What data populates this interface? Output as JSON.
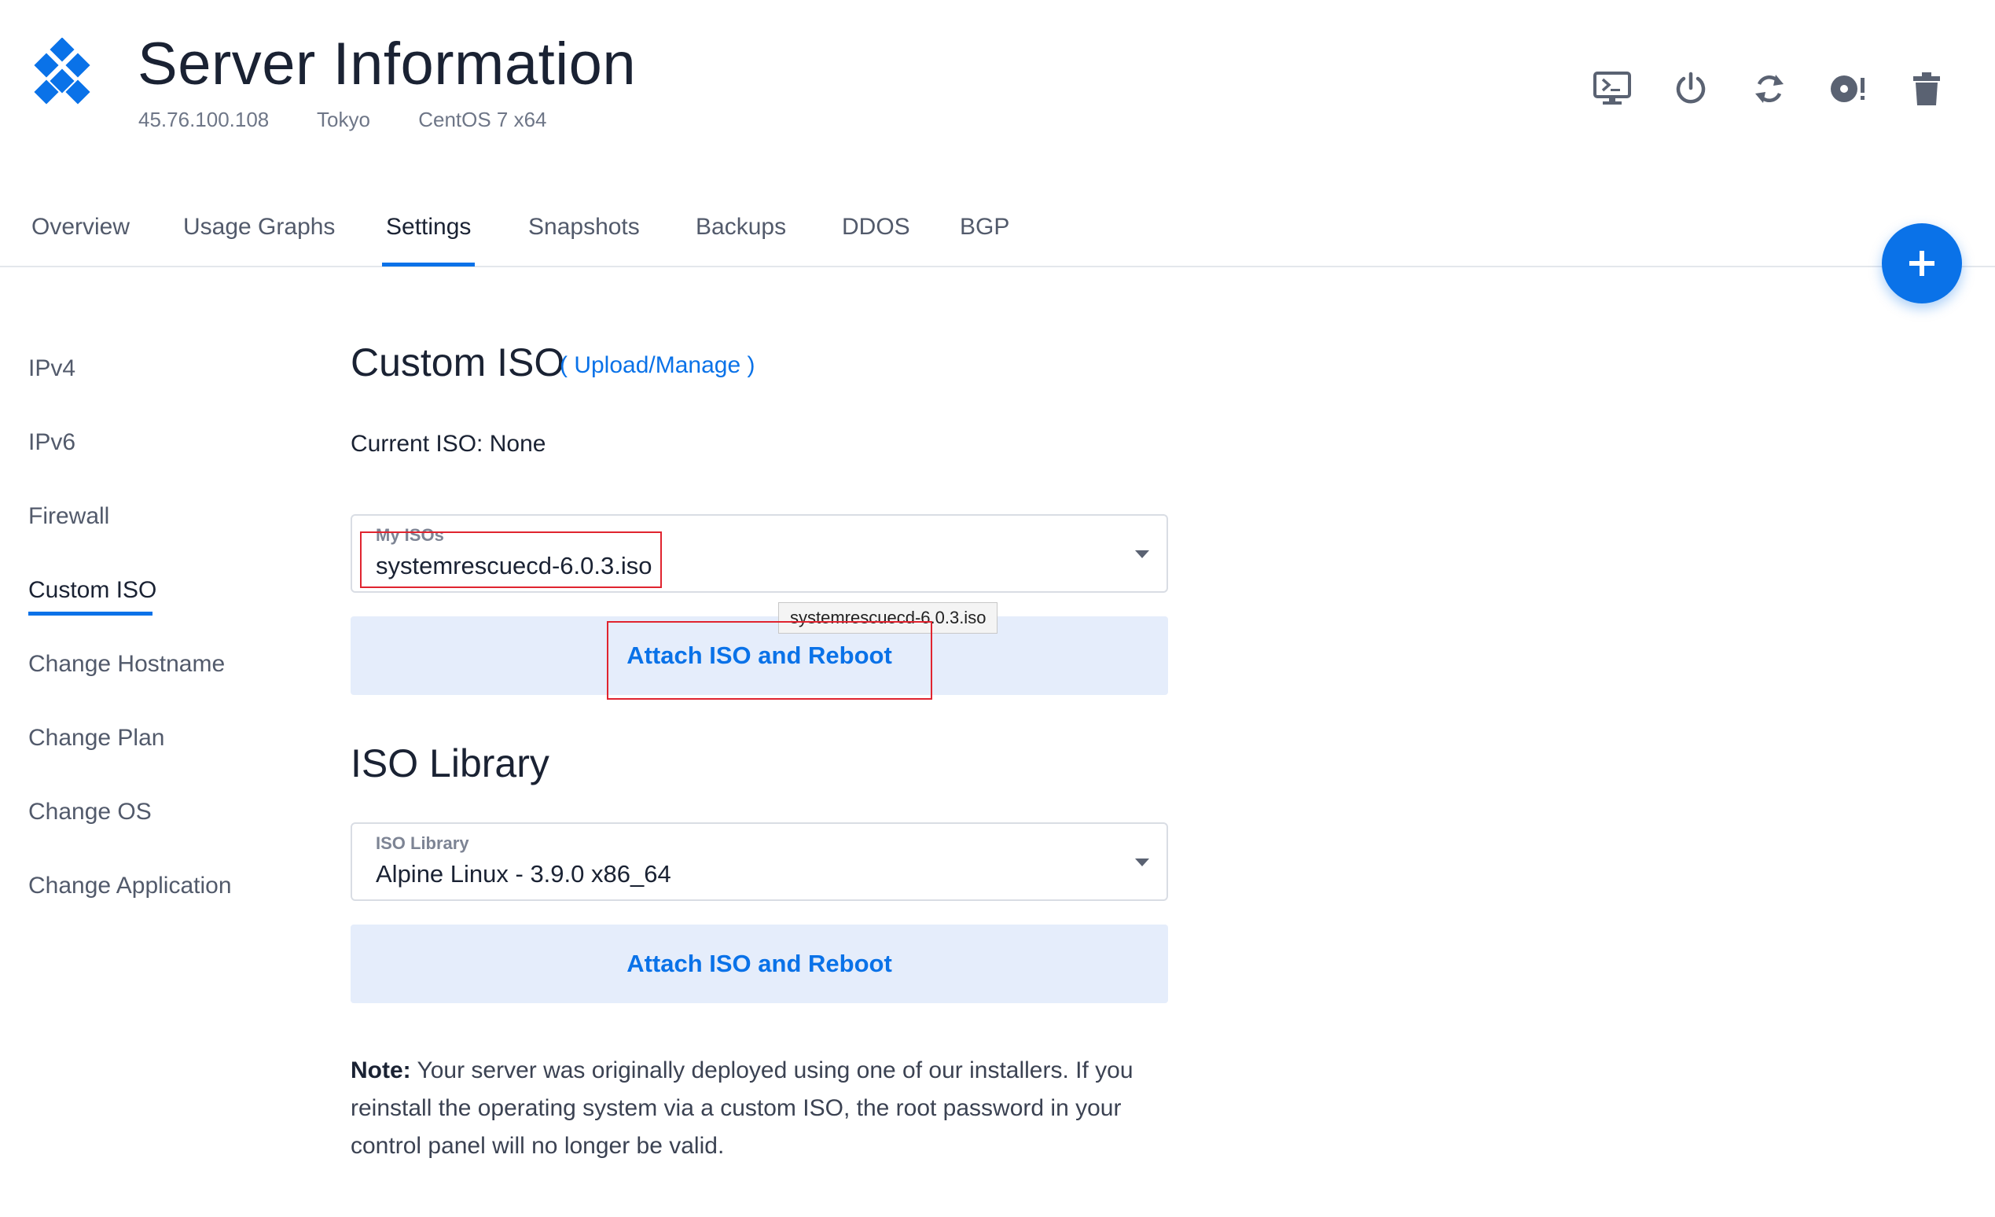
{
  "header": {
    "title": "Server Information",
    "ip": "45.76.100.108",
    "location": "Tokyo",
    "os": "CentOS 7 x64"
  },
  "actions": [
    {
      "icon": "console-icon"
    },
    {
      "icon": "power-icon"
    },
    {
      "icon": "restart-icon"
    },
    {
      "icon": "reinstall-icon"
    },
    {
      "icon": "trash-icon"
    }
  ],
  "tabs": [
    {
      "label": "Overview"
    },
    {
      "label": "Usage Graphs"
    },
    {
      "label": "Settings"
    },
    {
      "label": "Snapshots"
    },
    {
      "label": "Backups"
    },
    {
      "label": "DDOS"
    },
    {
      "label": "BGP"
    }
  ],
  "sidebar": [
    {
      "label": "IPv4"
    },
    {
      "label": "IPv6"
    },
    {
      "label": "Firewall"
    },
    {
      "label": "Custom ISO"
    },
    {
      "label": "Change Hostname"
    },
    {
      "label": "Change Plan"
    },
    {
      "label": "Change OS"
    },
    {
      "label": "Change Application"
    }
  ],
  "custom_iso": {
    "heading": "Custom ISO",
    "link": "( Upload/Manage )",
    "current": "Current ISO: None",
    "select_label": "My ISOs",
    "select_value": "systemrescuecd-6.0.3.iso",
    "tooltip": "systemrescuecd-6.0.3.iso",
    "button": "Attach ISO and Reboot"
  },
  "iso_library": {
    "heading": "ISO Library",
    "select_label": "ISO Library",
    "select_value": "Alpine Linux - 3.9.0 x86_64",
    "button": "Attach ISO and Reboot"
  },
  "note": {
    "prefix": "Note:",
    "text": " Your server was originally deployed using one of our installers. If you reinstall the operating system via a custom ISO, the root password in your control panel will no longer be valid."
  },
  "colors": {
    "accent": "#0a72e8",
    "highlight_box": "#e0242f"
  }
}
